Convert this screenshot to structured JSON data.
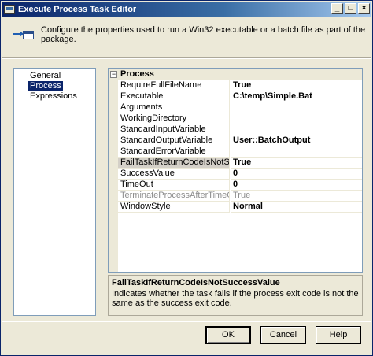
{
  "window": {
    "title": "Execute Process Task Editor",
    "controls": {
      "minimize": "_",
      "maximize": "□",
      "close": "×"
    }
  },
  "header": {
    "icon": "execute-process-icon",
    "description": "Configure the properties used to run a Win32 executable or a batch file as part of the package."
  },
  "nav": {
    "items": [
      {
        "label": "General",
        "selected": false
      },
      {
        "label": "Process",
        "selected": true
      },
      {
        "label": "Expressions",
        "selected": false
      }
    ]
  },
  "grid": {
    "category": {
      "toggle": "−",
      "label": "Process"
    },
    "properties": [
      {
        "name": "RequireFullFileName",
        "value": "True",
        "bold": true,
        "disabled": false,
        "selected": false
      },
      {
        "name": "Executable",
        "value": "C:\\temp\\Simple.Bat",
        "bold": true,
        "disabled": false,
        "selected": false
      },
      {
        "name": "Arguments",
        "value": "",
        "bold": false,
        "disabled": false,
        "selected": false
      },
      {
        "name": "WorkingDirectory",
        "value": "",
        "bold": false,
        "disabled": false,
        "selected": false
      },
      {
        "name": "StandardInputVariable",
        "value": "",
        "bold": false,
        "disabled": false,
        "selected": false
      },
      {
        "name": "StandardOutputVariable",
        "value": "User::BatchOutput",
        "bold": true,
        "disabled": false,
        "selected": false
      },
      {
        "name": "StandardErrorVariable",
        "value": "",
        "bold": false,
        "disabled": false,
        "selected": false
      },
      {
        "name": "FailTaskIfReturnCodeIsNotSuccessValue",
        "value": "True",
        "bold": true,
        "disabled": false,
        "selected": true
      },
      {
        "name": "SuccessValue",
        "value": "0",
        "bold": true,
        "disabled": false,
        "selected": false
      },
      {
        "name": "TimeOut",
        "value": "0",
        "bold": true,
        "disabled": false,
        "selected": false
      },
      {
        "name": "TerminateProcessAfterTimeOut",
        "value": "True",
        "bold": false,
        "disabled": true,
        "selected": false
      },
      {
        "name": "WindowStyle",
        "value": "Normal",
        "bold": true,
        "disabled": false,
        "selected": false
      }
    ]
  },
  "description": {
    "title": "FailTaskIfReturnCodeIsNotSuccessValue",
    "text": "Indicates whether the task fails if the process exit code is not the same as the success exit code."
  },
  "buttons": {
    "ok": "OK",
    "cancel": "Cancel",
    "help": "Help"
  }
}
